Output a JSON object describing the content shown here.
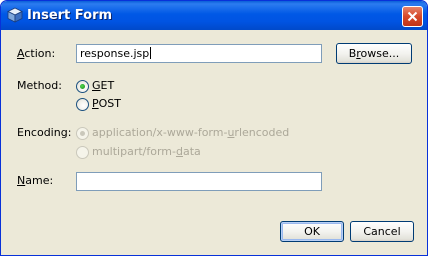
{
  "window": {
    "title": "Insert Form"
  },
  "form": {
    "action": {
      "label_mnemonic": "A",
      "label_rest": "ction:",
      "value": "response.jsp",
      "browse_mnemonic": "r",
      "browse_prefix": "B",
      "browse_rest": "owse..."
    },
    "method": {
      "label": "Method:",
      "options": [
        {
          "mnemonic": "G",
          "rest": "ET",
          "selected": true
        },
        {
          "mnemonic": "P",
          "rest": "OST",
          "selected": false
        }
      ]
    },
    "encoding": {
      "label": "Encoding:",
      "options": [
        {
          "prefix": "application/x-www-form-",
          "mnemonic": "u",
          "rest": "rlencoded",
          "selected": true,
          "disabled": true
        },
        {
          "prefix": "multipart/form-",
          "mnemonic": "d",
          "rest": "ata",
          "selected": false,
          "disabled": true
        }
      ]
    },
    "name": {
      "label_mnemonic": "N",
      "label_rest": "ame:",
      "value": ""
    }
  },
  "buttons": {
    "ok": "OK",
    "cancel": "Cancel"
  },
  "colors": {
    "title_bar": "#0054e3",
    "dialog_bg": "#ece9d8",
    "close_button": "#d6492a",
    "disabled_text": "#aca899",
    "radio_selected": "#2ca82c"
  },
  "icons": {
    "title": "netbeans-cube-icon",
    "close": "close-x-icon"
  }
}
